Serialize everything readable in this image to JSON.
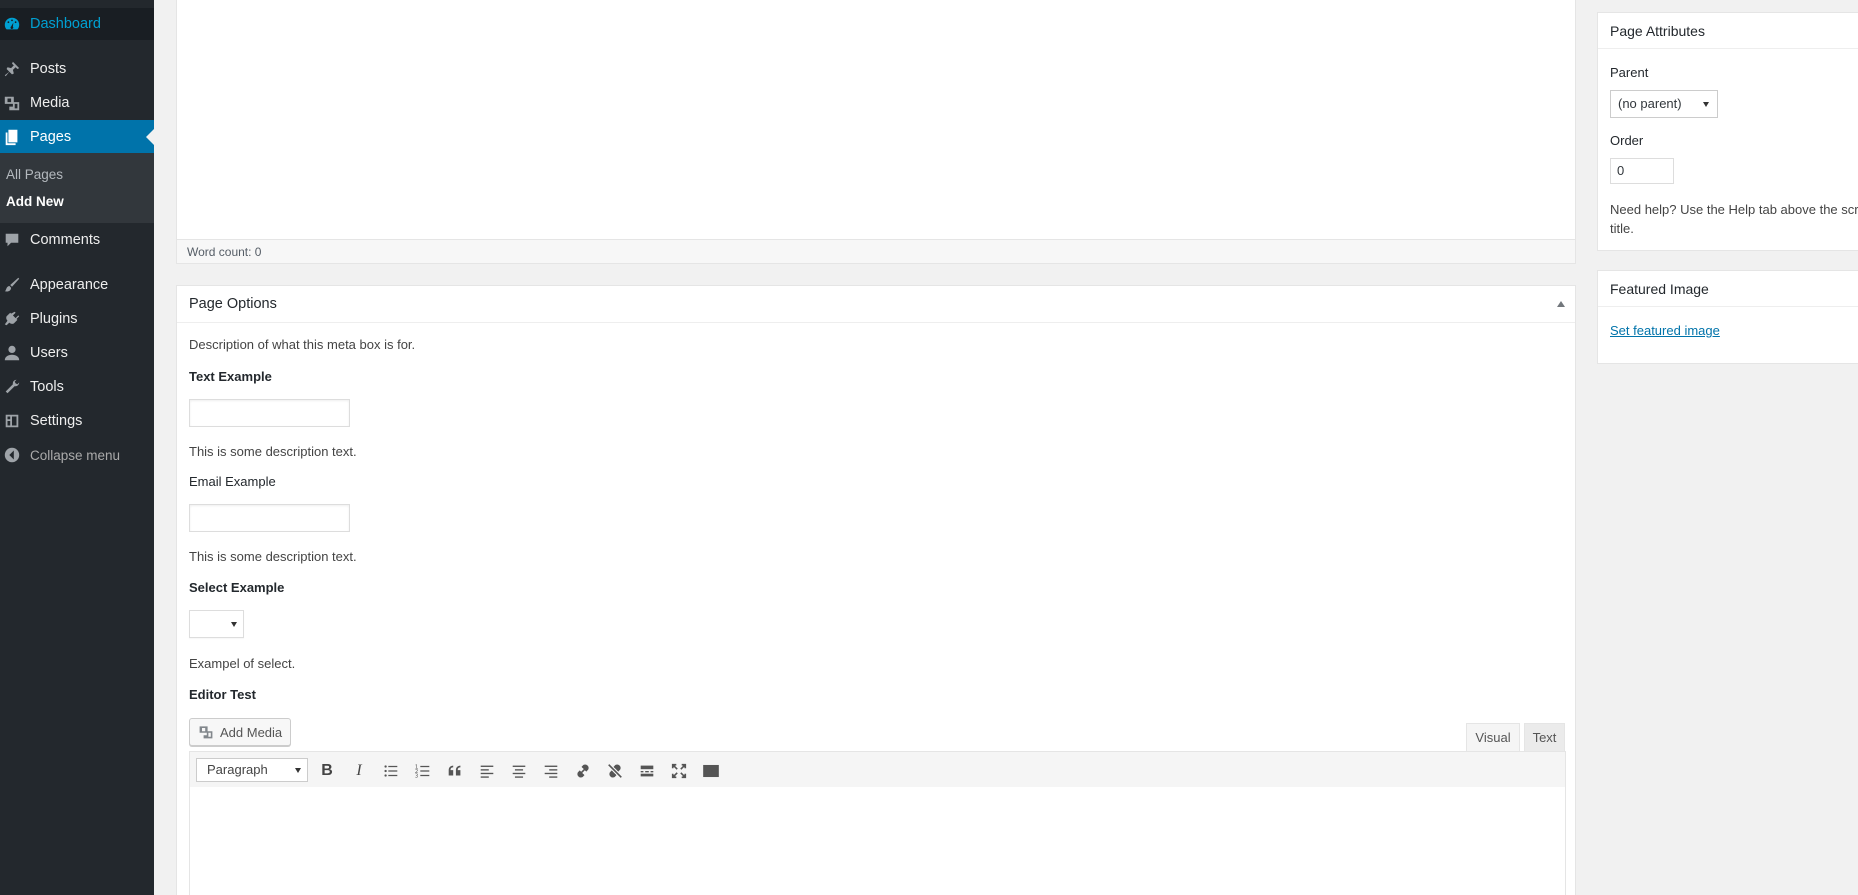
{
  "sidebar": {
    "items": [
      {
        "label": "Dashboard",
        "icon": "dashboard-icon"
      },
      {
        "label": "Posts",
        "icon": "pushpin-icon"
      },
      {
        "label": "Media",
        "icon": "media-icon"
      },
      {
        "label": "Pages",
        "icon": "pages-icon"
      },
      {
        "label": "Comments",
        "icon": "comment-icon"
      },
      {
        "label": "Appearance",
        "icon": "paintbrush-icon"
      },
      {
        "label": "Plugins",
        "icon": "plugin-icon"
      },
      {
        "label": "Users",
        "icon": "user-icon"
      },
      {
        "label": "Tools",
        "icon": "wrench-icon"
      },
      {
        "label": "Settings",
        "icon": "settings-icon"
      }
    ],
    "submenu": [
      "All Pages",
      "Add New"
    ],
    "collapse_label": "Collapse menu"
  },
  "editor": {
    "word_count": "Word count: 0"
  },
  "page_options": {
    "title": "Page Options",
    "description": "Description of what this meta box is for.",
    "text_label": "Text Example",
    "text_desc": "This is some description text.",
    "email_label": "Email Example",
    "email_desc": "This is some description text.",
    "select_label": "Select Example",
    "select_desc": "Exampel of select.",
    "editor_label": "Editor Test",
    "add_media": "Add Media",
    "tab_visual": "Visual",
    "tab_text": "Text",
    "format_select": "Paragraph"
  },
  "page_attributes": {
    "title": "Page Attributes",
    "parent_label": "Parent",
    "parent_value": "(no parent)",
    "order_label": "Order",
    "order_value": "0",
    "help": "Need help? Use the Help tab above the screen title."
  },
  "featured_image": {
    "title": "Featured Image",
    "link": "Set featured image"
  },
  "colors": {
    "menu_bg": "#23282d",
    "menu_active": "#0073aa",
    "link": "#0073aa"
  }
}
